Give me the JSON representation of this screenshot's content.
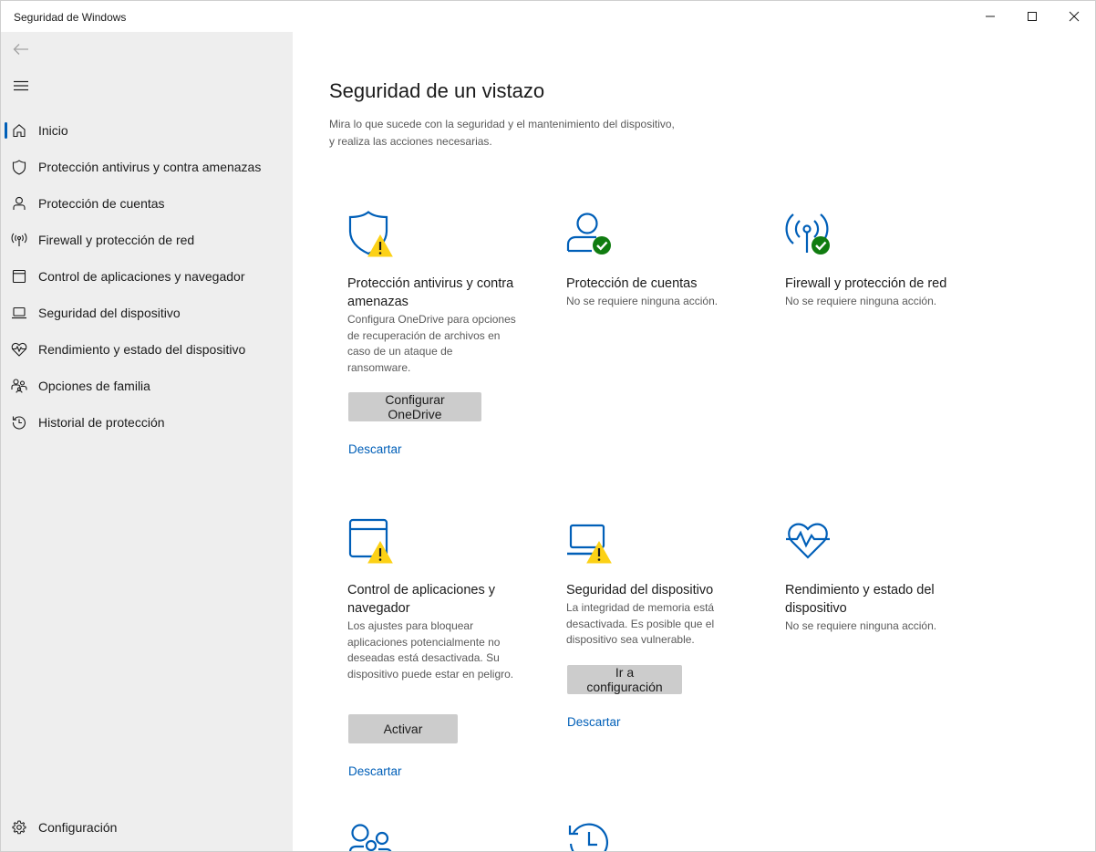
{
  "window": {
    "title": "Seguridad de Windows",
    "controls": [
      "minimize-icon",
      "maximize-icon",
      "close-icon"
    ]
  },
  "sidebar": {
    "back_icon": "back-arrow-icon",
    "menu_icon": "hamburger-icon",
    "items": [
      {
        "label": "Inicio",
        "icon": "home-icon",
        "active": true
      },
      {
        "label": "Protección antivirus y contra amenazas",
        "icon": "shield-icon"
      },
      {
        "label": "Protección de cuentas",
        "icon": "person-icon"
      },
      {
        "label": "Firewall y protección de red",
        "icon": "wifi-antenna-icon"
      },
      {
        "label": "Control de aplicaciones y navegador",
        "icon": "browser-window-icon"
      },
      {
        "label": "Seguridad del dispositivo",
        "icon": "laptop-icon"
      },
      {
        "label": "Rendimiento y estado del dispositivo",
        "icon": "heart-pulse-icon"
      },
      {
        "label": "Opciones de familia",
        "icon": "family-icon"
      },
      {
        "label": "Historial de protección",
        "icon": "history-icon"
      }
    ],
    "settings": {
      "label": "Configuración",
      "icon": "gear-icon"
    }
  },
  "main": {
    "title": "Seguridad de un vistazo",
    "description": "Mira lo que sucede con la seguridad y el mantenimiento del dispositivo, y realiza las acciones necesarias.",
    "cards": [
      {
        "title": "Protección antivirus y contra amenazas",
        "description": "Configura OneDrive para opciones de recuperación de archivos en caso de un ataque de ransomware.",
        "button": "Configurar OneDrive",
        "link": "Descartar",
        "icon": "shield-icon",
        "status": "warning"
      },
      {
        "title": "Protección de cuentas",
        "description": "No se requiere ninguna acción.",
        "icon": "person-icon",
        "status": "ok"
      },
      {
        "title": "Firewall y protección de red",
        "description": "No se requiere ninguna acción.",
        "icon": "wifi-antenna-icon",
        "status": "ok"
      },
      {
        "title": "Control de aplicaciones y navegador",
        "description": "Los ajustes para bloquear aplicaciones potencialmente no deseadas está desactivada. Su dispositivo puede estar en peligro.",
        "button": "Activar",
        "link": "Descartar",
        "icon": "browser-window-icon",
        "status": "warning"
      },
      {
        "title": "Seguridad del dispositivo",
        "description": "La integridad de memoria está desactivada. Es posible que el dispositivo sea vulnerable.",
        "button": "Ir a configuración",
        "link": "Descartar",
        "icon": "laptop-icon",
        "status": "warning"
      },
      {
        "title": "Rendimiento y estado del dispositivo",
        "description": "No se requiere ninguna acción.",
        "icon": "heart-pulse-icon",
        "status": "none"
      },
      {
        "icon": "family-icon"
      },
      {
        "icon": "history-icon"
      }
    ]
  },
  "colors": {
    "accent": "#005fb8",
    "sidebar_bg": "#eeeeee",
    "warning": "#fcd116",
    "ok": "#107c10",
    "button_bg": "#cccccc"
  }
}
